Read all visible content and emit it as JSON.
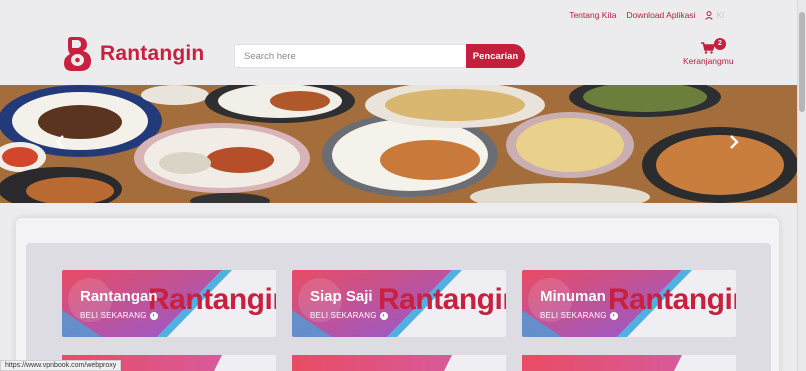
{
  "header": {
    "links": [
      "Tentang Kita",
      "Download Aplikasi"
    ],
    "user_label": "Kl"
  },
  "brand": {
    "name": "Rantangin",
    "color": "#c8203f"
  },
  "search": {
    "placeholder": "Search here",
    "value": "",
    "button_label": "Pencarian"
  },
  "cart": {
    "count": "2",
    "label": "Keranjangmu"
  },
  "banner": {
    "prev_icon": "chevron-left-icon",
    "next_icon": "chevron-right-icon"
  },
  "categories": [
    {
      "title": "Rantangan",
      "cta": "BELI SEKARANG",
      "watermark": "Rantangin"
    },
    {
      "title": "Siap Saji",
      "cta": "BELI SEKARANG",
      "watermark": "Rantangin"
    },
    {
      "title": "Minuman",
      "cta": "BELI SEKARANG",
      "watermark": "Rantangin"
    }
  ],
  "status_url": "https://www.vpnbook.com/webproxy",
  "colors": {
    "accent": "#c51f3e",
    "gradient_start": "#e94c63",
    "gradient_end": "#8f5bd6",
    "cyan": "#3fa8e0"
  }
}
